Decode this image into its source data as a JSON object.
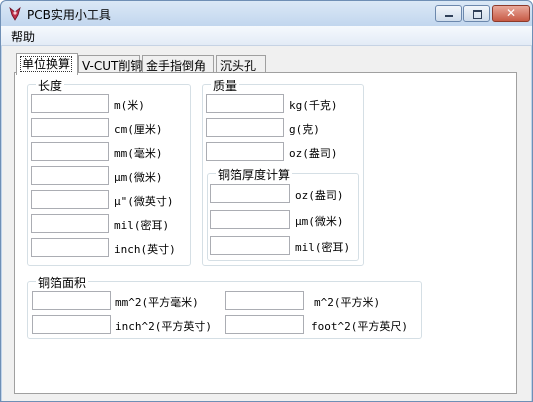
{
  "window": {
    "title": "PCB实用小工具",
    "accent_color": "#bfd3ea"
  },
  "menu": {
    "help_label": "帮助"
  },
  "tabs": [
    {
      "label": "单位换算",
      "selected": true
    },
    {
      "label": "V-CUT削铜",
      "selected": false
    },
    {
      "label": "金手指倒角",
      "selected": false
    },
    {
      "label": "沉头孔",
      "selected": false
    }
  ],
  "length": {
    "title": "长度",
    "fields": [
      {
        "value": "",
        "unit": "m(米)"
      },
      {
        "value": "",
        "unit": "cm(厘米)"
      },
      {
        "value": "",
        "unit": "mm(毫米)"
      },
      {
        "value": "",
        "unit": "μm(微米)"
      },
      {
        "value": "",
        "unit": "μ\"(微英寸)"
      },
      {
        "value": "",
        "unit": "mil(密耳)"
      },
      {
        "value": "",
        "unit": "inch(英寸)"
      }
    ]
  },
  "mass": {
    "title": "质量",
    "fields": [
      {
        "value": "",
        "unit": "kg(千克)"
      },
      {
        "value": "",
        "unit": "g(克)"
      },
      {
        "value": "",
        "unit": "oz(盎司)"
      }
    ]
  },
  "copper_thickness": {
    "title": "铜箔厚度计算",
    "fields": [
      {
        "value": "",
        "unit": "oz(盎司)"
      },
      {
        "value": "",
        "unit": "μm(微米)"
      },
      {
        "value": "",
        "unit": "mil(密耳)"
      }
    ]
  },
  "copper_area": {
    "title": "铜箔面积",
    "fields": [
      {
        "value": "",
        "unit": "mm^2(平方毫米)"
      },
      {
        "value": "",
        "unit": "m^2(平方米)"
      },
      {
        "value": "",
        "unit": "inch^2(平方英寸)"
      },
      {
        "value": "",
        "unit": "foot^2(平方英尺)"
      }
    ]
  }
}
